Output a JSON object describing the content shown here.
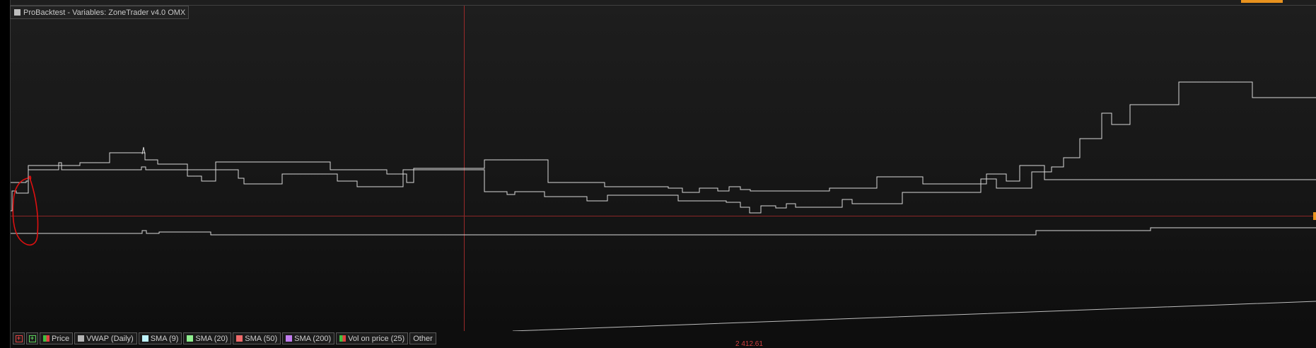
{
  "window": {
    "title": "ProBacktest - Variables: ZoneTrader v4.0 OMX"
  },
  "legend": {
    "add_indicator_icon": "add-indicator-icon",
    "add_panel_icon": "add-panel-icon",
    "items": [
      {
        "label": "Price",
        "color": "#3fbf3f"
      },
      {
        "label": "VWAP (Daily)",
        "color": "#b5b5b5"
      },
      {
        "label": "SMA (9)",
        "color": "#bff4ff"
      },
      {
        "label": "SMA (20)",
        "color": "#8fef8f"
      },
      {
        "label": "SMA (50)",
        "color": "#f06a6a"
      },
      {
        "label": "SMA (200)",
        "color": "#c27df0"
      },
      {
        "label": "Vol on price (25)",
        "color": "#3fbf3f"
      }
    ],
    "other_label": "Other"
  },
  "crosshair": {
    "price_label": "2 412.61",
    "color": "#cc3333"
  },
  "colors": {
    "accent": "#e8921e",
    "series_line": "#d8d8d8",
    "annotation": "#dd1010"
  }
}
